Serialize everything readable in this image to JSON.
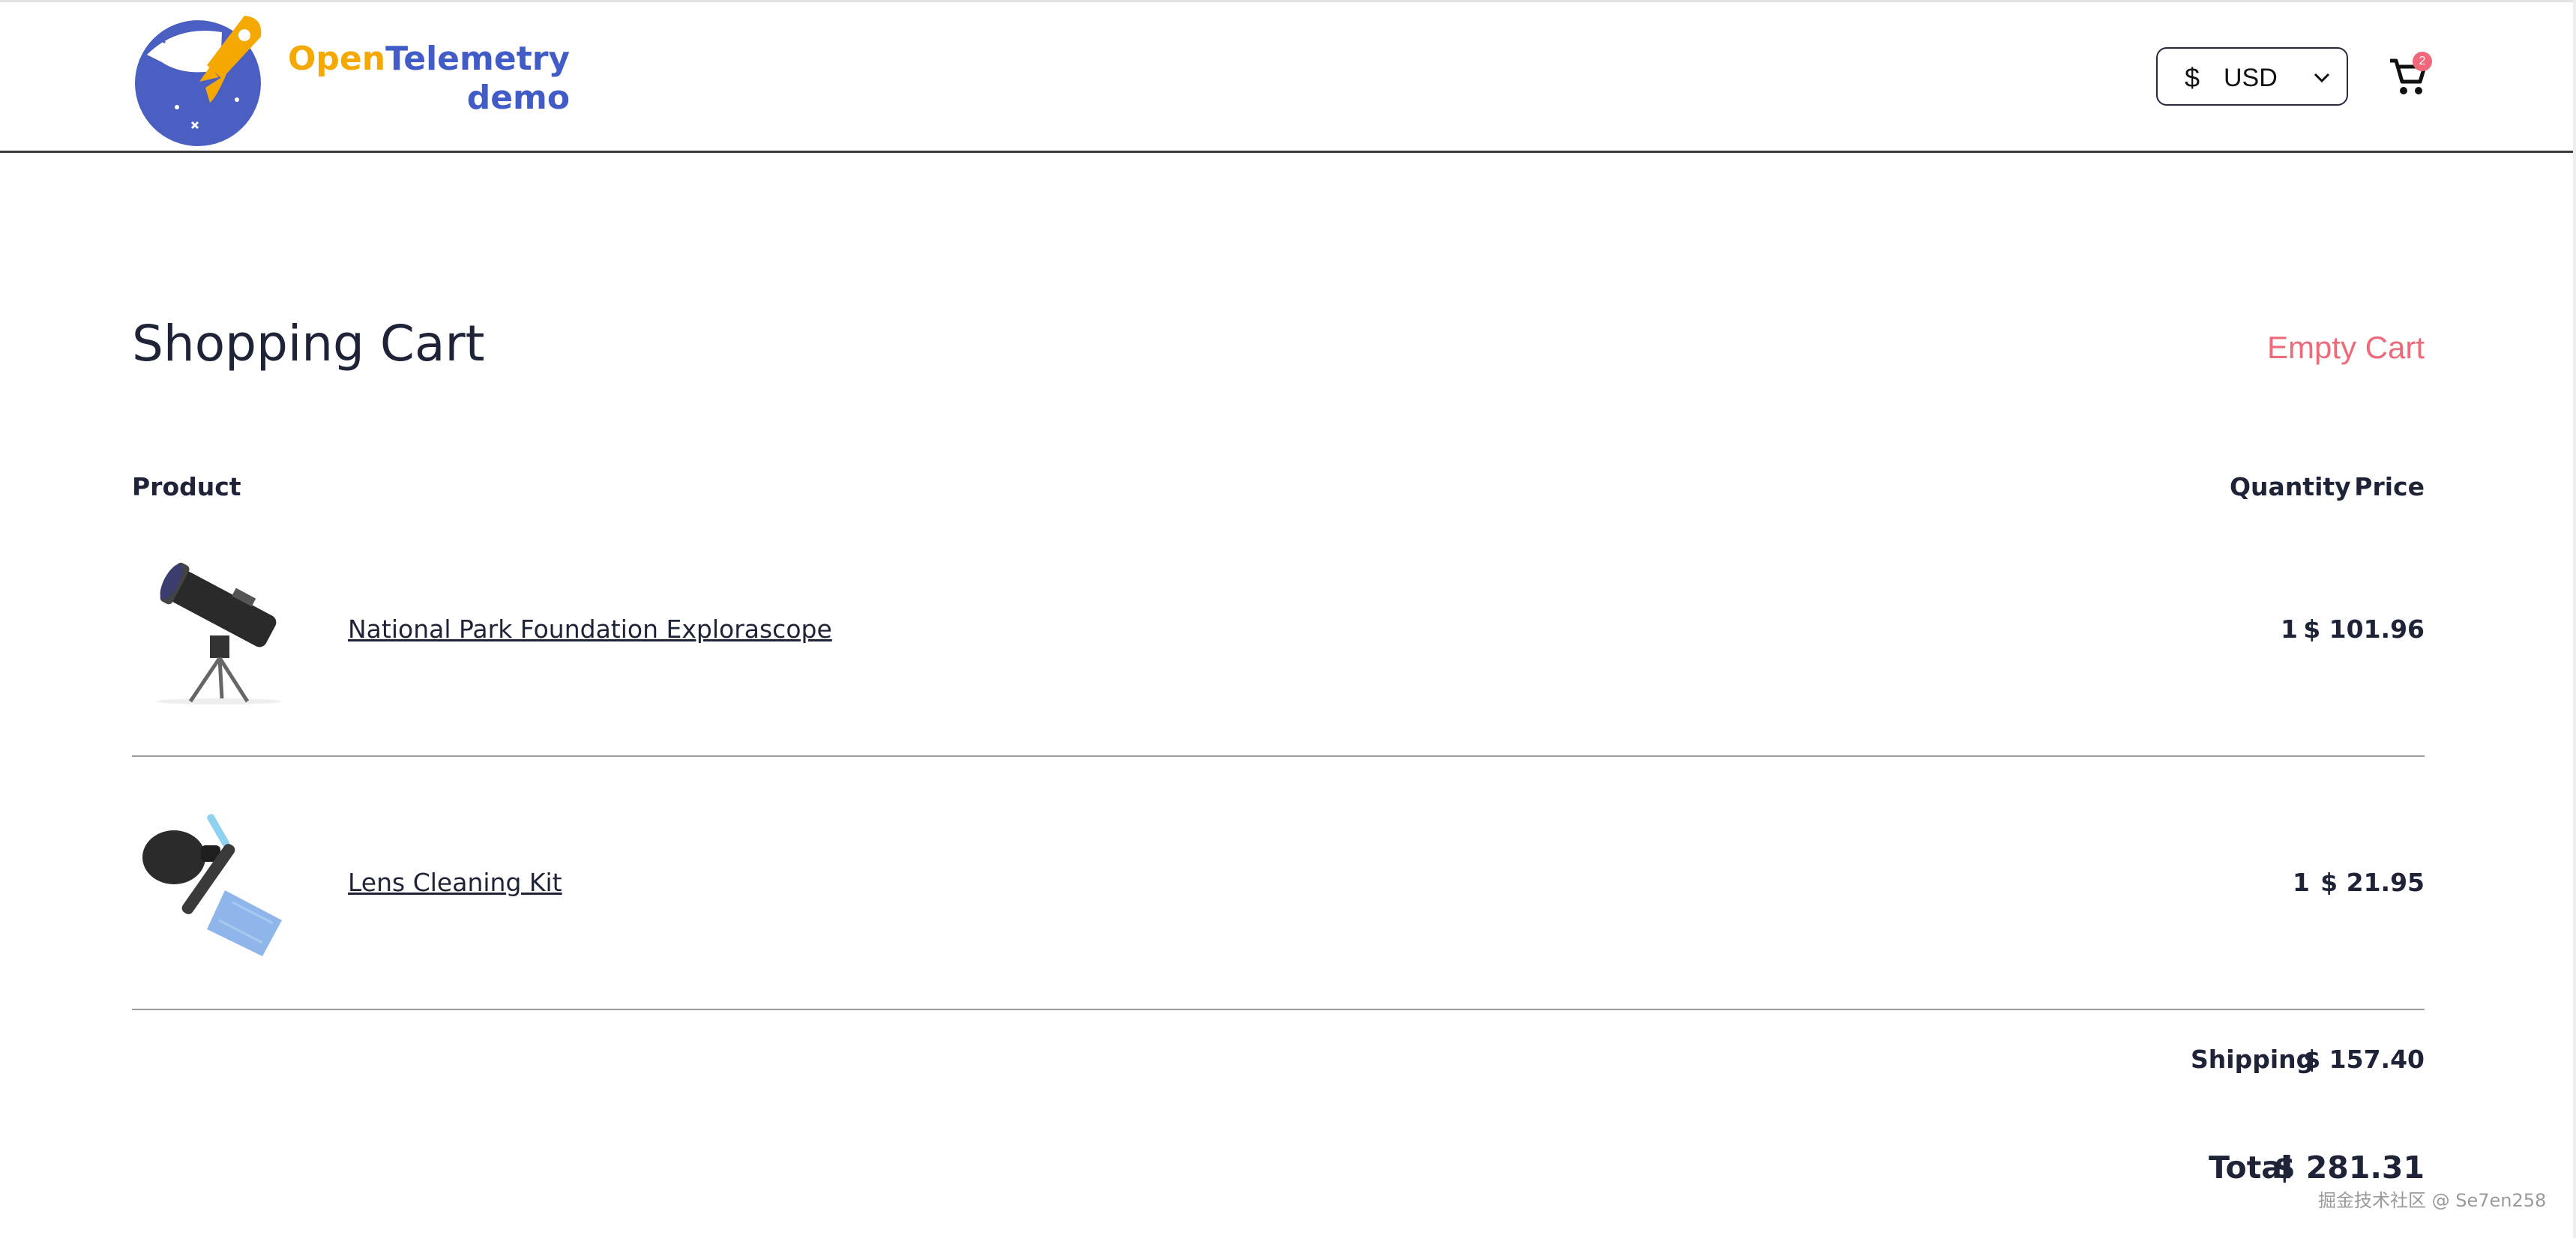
{
  "header": {
    "logo_word1": "Open",
    "logo_word2": "Telemetry",
    "logo_word3": "demo",
    "currency_symbol": "$",
    "currency_code": "USD",
    "cart_count": "2"
  },
  "cart": {
    "title": "Shopping Cart",
    "empty_label": "Empty Cart",
    "columns": {
      "product": "Product",
      "quantity": "Quantity",
      "price": "Price"
    },
    "items": [
      {
        "name": "National Park Foundation Explorascope",
        "quantity": "1",
        "price": "$ 101.96",
        "icon": "telescope-image"
      },
      {
        "name": "Lens Cleaning Kit",
        "quantity": "1",
        "price": "$ 21.95",
        "icon": "lens-cleaning-kit-image"
      }
    ],
    "shipping_label": "Shipping",
    "shipping_value": "$ 157.40",
    "total_label": "Total",
    "total_value": "$ 281.31"
  },
  "watermark": "掘金技术社区 @ Se7en258",
  "colors": {
    "accent_orange": "#f5a800",
    "brand_blue": "#425cc7",
    "danger_pink": "#ec6a7a",
    "text_dark": "#1f2337"
  }
}
